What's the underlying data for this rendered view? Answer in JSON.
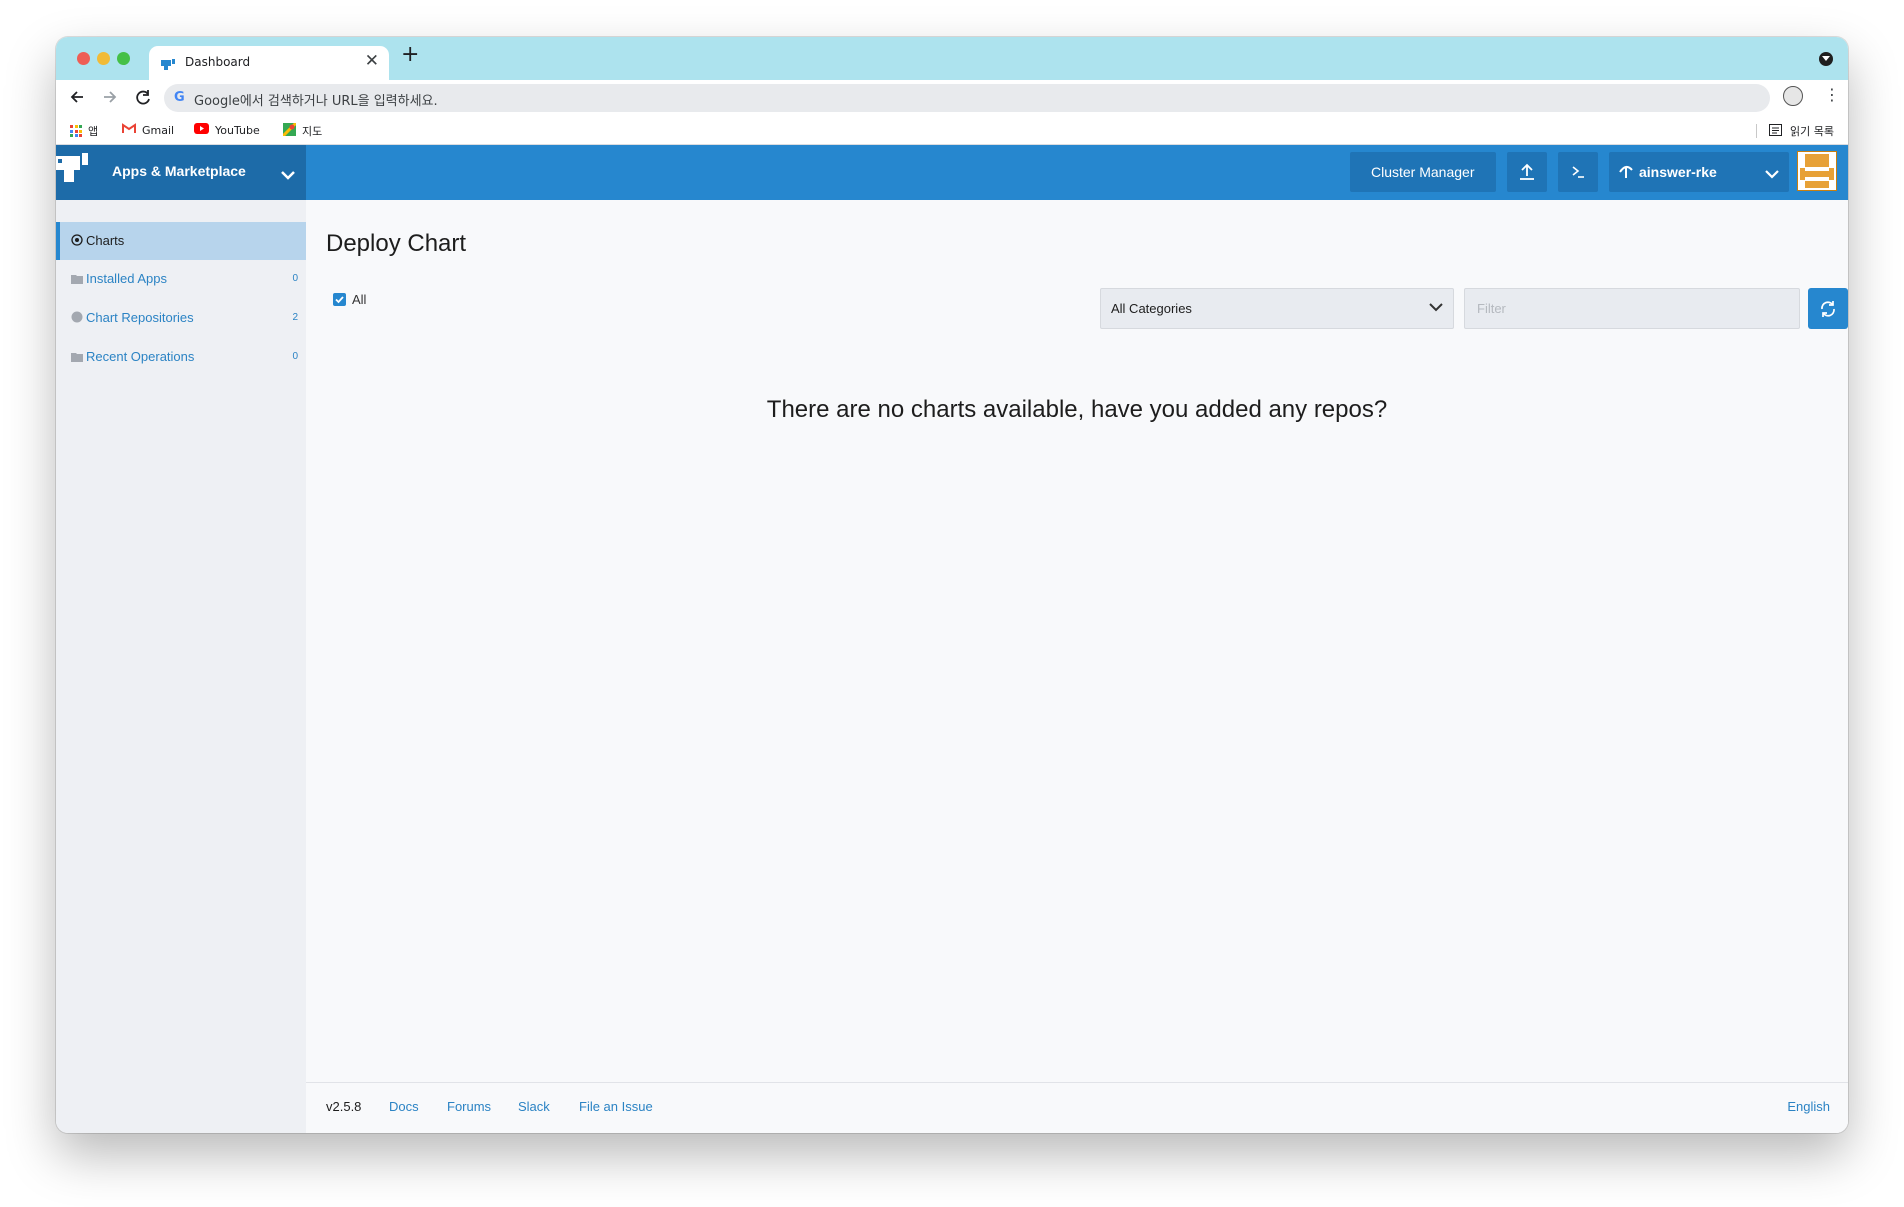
{
  "browser": {
    "tab_title": "Dashboard",
    "new_tab_symbol": "+",
    "close_symbol": "✕",
    "address_placeholder": "Google에서 검색하거나 URL을 입력하세요.",
    "bookmarks": [
      {
        "label": "앱",
        "icon": "apps-grid-icon"
      },
      {
        "label": "Gmail",
        "icon": "gmail-icon"
      },
      {
        "label": "YouTube",
        "icon": "youtube-icon"
      },
      {
        "label": "지도",
        "icon": "maps-icon"
      }
    ],
    "reading_list": "읽기 목록"
  },
  "header": {
    "app_title": "Apps & Marketplace",
    "cluster_manager": "Cluster Manager",
    "cluster_name": "ainswer-rke"
  },
  "sidebar": {
    "items": [
      {
        "label": "Charts",
        "count": "",
        "icon": "circle-dot-icon",
        "active": true
      },
      {
        "label": "Installed Apps",
        "count": "0",
        "icon": "folder-icon",
        "active": false
      },
      {
        "label": "Chart Repositories",
        "count": "2",
        "icon": "circle-icon",
        "active": false
      },
      {
        "label": "Recent Operations",
        "count": "0",
        "icon": "folder-icon",
        "active": false
      }
    ]
  },
  "main": {
    "title": "Deploy Chart",
    "all_label": "All",
    "category_selected": "All Categories",
    "filter_placeholder": "Filter",
    "empty_message": "There are no charts available, have you added any repos?"
  },
  "footer": {
    "version": "v2.5.8",
    "links": [
      "Docs",
      "Forums",
      "Slack",
      "File an Issue"
    ],
    "language": "English"
  },
  "colors": {
    "header_blue": "#2687cf",
    "brand_blue": "#1d6ba8",
    "link_blue": "#2b83c4",
    "tabstrip": "#ade3ee"
  }
}
